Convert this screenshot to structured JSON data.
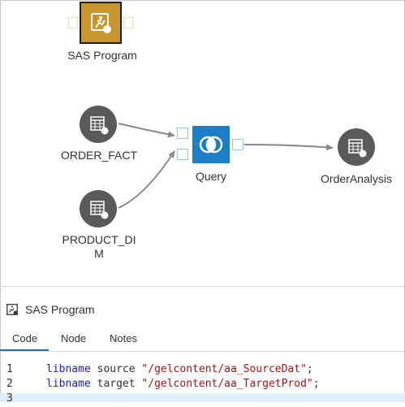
{
  "flow": {
    "sas_program_label": "SAS Program",
    "order_fact_label": "ORDER_FACT",
    "product_dim_label_line1": "PRODUCT_DI",
    "product_dim_label_line2": "M",
    "query_label": "Query",
    "order_analysis_label": "OrderAnalysis"
  },
  "panel": {
    "title": "SAS Program",
    "tabs": [
      "Code",
      "Node",
      "Notes"
    ],
    "active_tab": "Code"
  },
  "code": {
    "lines": [
      {
        "num": "1",
        "keyword": "libname",
        "ident": " source ",
        "string": "\"/gelcontent/aa_SourceDat\"",
        "end": ";"
      },
      {
        "num": "2",
        "keyword": "libname",
        "ident": " target ",
        "string": "\"/gelcontent/aa_TargetProd\"",
        "end": ";"
      },
      {
        "num": "3"
      }
    ]
  },
  "colors": {
    "accent": "#1a75b8",
    "query_node": "#1a7fc4",
    "program_node": "#c8962c",
    "table_node": "#5a5a5a",
    "port_blue": "#8fcbe8",
    "keyword": "#1b1bd9",
    "string": "#a31515"
  }
}
